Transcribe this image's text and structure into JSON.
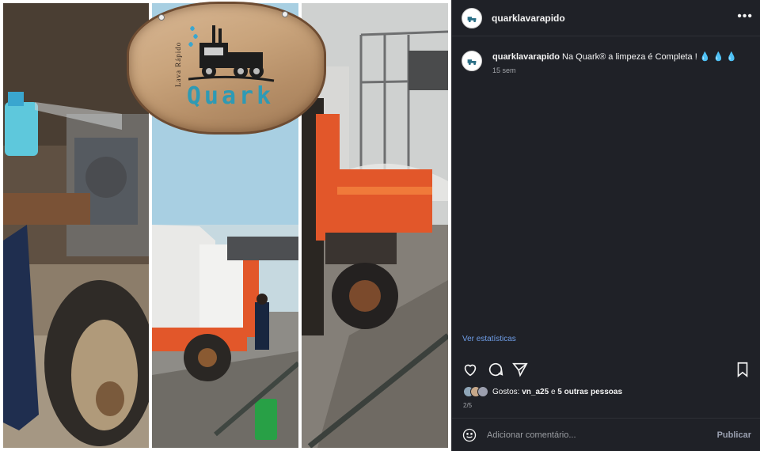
{
  "post": {
    "username": "quarklavarapido",
    "caption_user": "quarklavarapido",
    "caption_text": "Na Quark® a limpeza é Completa ! 💧 💧 💧",
    "caption_age": "15 sem",
    "stats_link": "Ver estatísticas",
    "likes_prefix": "Gostos:",
    "likes_user": "vn_a25",
    "likes_middle": "e",
    "likes_others": "5 outras pessoas",
    "page_indicator": "2/5",
    "comment_placeholder": "Adicionar comentário...",
    "publish_label": "Publicar"
  },
  "photo": {
    "sign_tagline": "Lava Rápido",
    "sign_brand": "Quark"
  },
  "icons": {
    "more": "more-options-icon",
    "like": "heart-icon",
    "comment": "comment-icon",
    "share": "send-icon",
    "save": "bookmark-icon",
    "emoji": "emoji-icon"
  },
  "colors": {
    "sidebar_bg": "#1f2127",
    "link": "#6f9ee8",
    "brand": "#2f9ab4",
    "truck_orange": "#e2572a"
  }
}
